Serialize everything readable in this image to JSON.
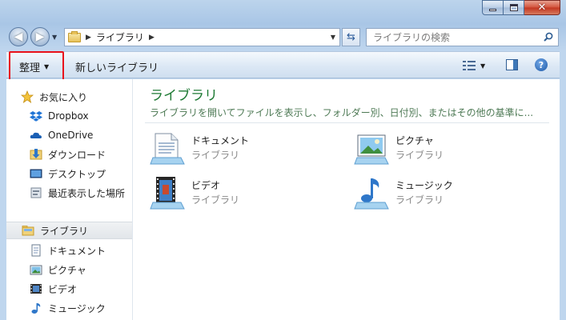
{
  "address": {
    "crumb": "ライブラリ"
  },
  "search": {
    "placeholder": "ライブラリの検索"
  },
  "toolbar": {
    "organize_label": "整理",
    "new_library_label": "新しいライブラリ"
  },
  "nav_pane": {
    "favorites": {
      "label": "お気に入り",
      "items": [
        {
          "label": "Dropbox",
          "icon": "dropbox-icon"
        },
        {
          "label": "OneDrive",
          "icon": "onedrive-icon"
        },
        {
          "label": "ダウンロード",
          "icon": "downloads-folder-icon"
        },
        {
          "label": "デスクトップ",
          "icon": "desktop-icon"
        },
        {
          "label": "最近表示した場所",
          "icon": "recent-places-icon"
        }
      ]
    },
    "libraries": {
      "label": "ライブラリ",
      "items": [
        {
          "label": "ドキュメント",
          "icon": "documents-icon"
        },
        {
          "label": "ピクチャ",
          "icon": "pictures-icon"
        },
        {
          "label": "ビデオ",
          "icon": "videos-icon"
        },
        {
          "label": "ミュージック",
          "icon": "music-icon"
        }
      ]
    }
  },
  "content": {
    "title": "ライブラリ",
    "description": "ライブラリを開いてファイルを表示し、フォルダー別、日付別、またはその他の基準に...",
    "libraries": [
      {
        "name": "ドキュメント",
        "type": "ライブラリ",
        "icon": "documents-library-icon"
      },
      {
        "name": "ピクチャ",
        "type": "ライブラリ",
        "icon": "pictures-library-icon"
      },
      {
        "name": "ビデオ",
        "type": "ライブラリ",
        "icon": "videos-library-icon"
      },
      {
        "name": "ミュージック",
        "type": "ライブラリ",
        "icon": "music-library-icon"
      }
    ]
  },
  "colors": {
    "title_green": "#1e7a34",
    "highlight_red": "#e8121b",
    "window_blue": "#a9c6e6"
  }
}
